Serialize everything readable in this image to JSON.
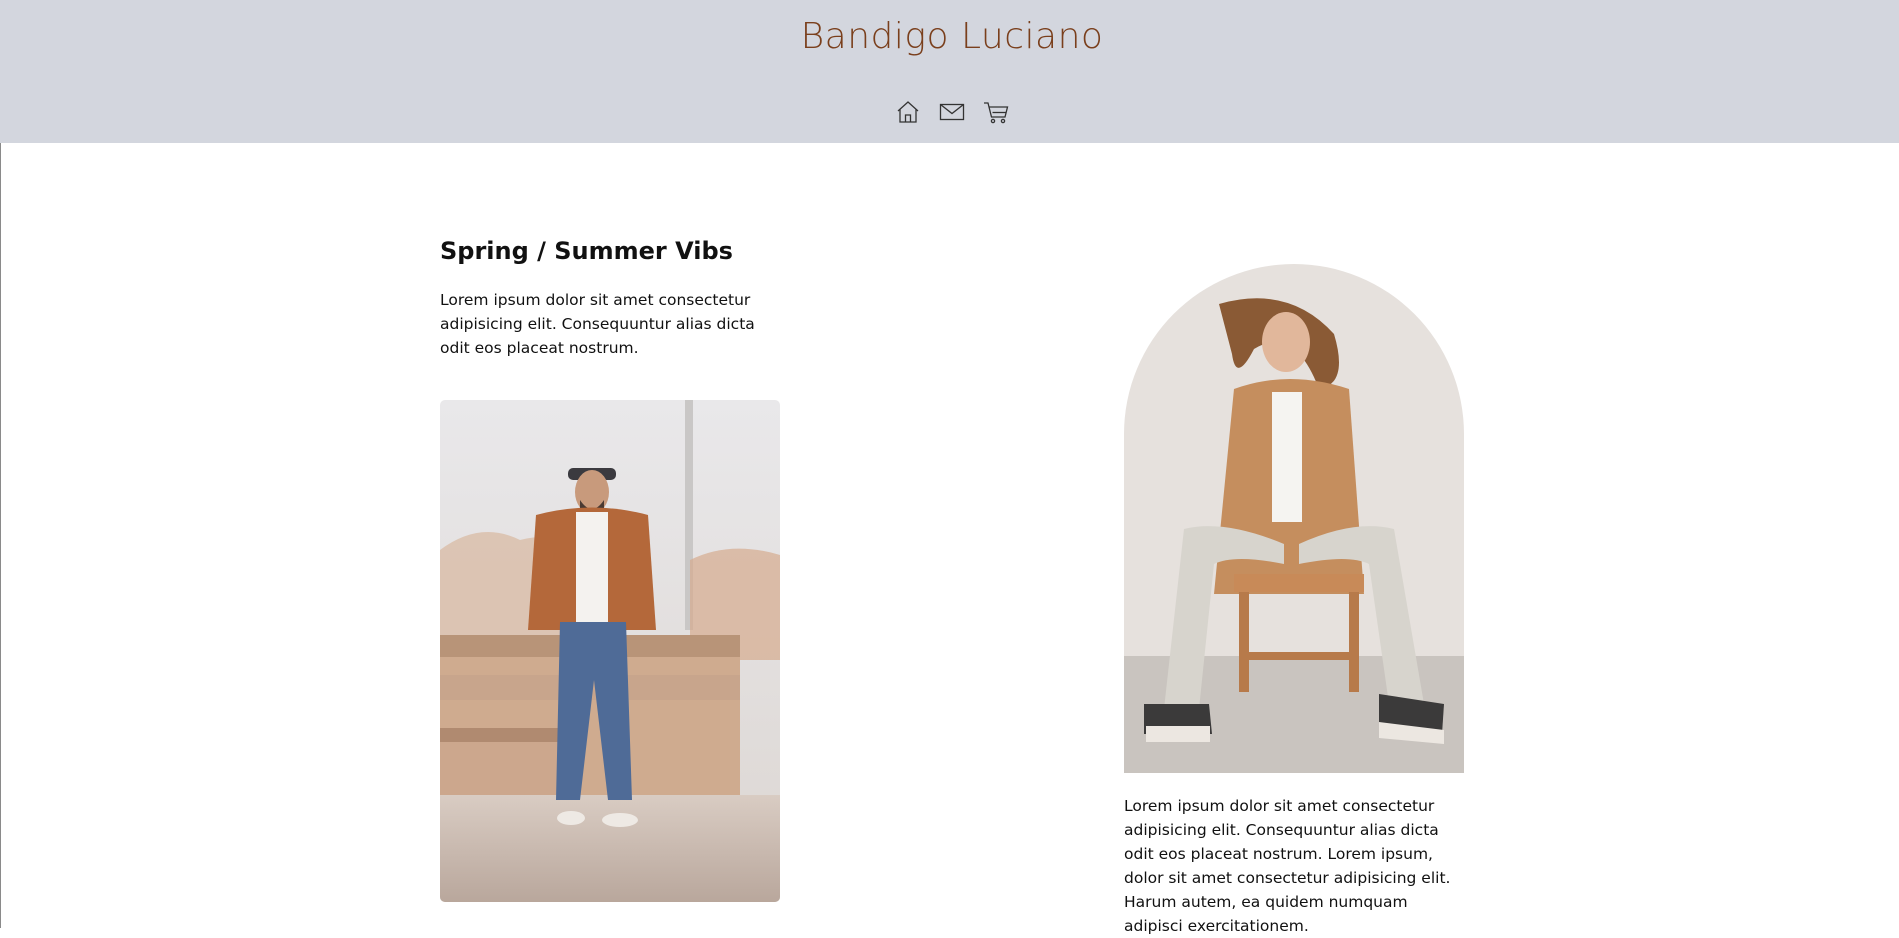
{
  "header": {
    "brand": "Bandigo Luciano",
    "brand_color": "#7a3f1c",
    "background": "#d3d6de",
    "nav_icons": [
      "home-icon",
      "mail-icon",
      "cart-icon"
    ]
  },
  "section": {
    "title": "Spring / Summer Vibs",
    "intro": "Lorem ipsum dolor sit amet consectetur adipisicing elit. Consequuntur alias dicta odit eos placeat nostrum.",
    "description": "Lorem ipsum dolor sit amet consectetur adipisicing elit. Consequuntur alias dicta odit eos placeat nostrum. Lorem ipsum, dolor sit amet consectetur adipisicing elit. Harum autem, ea quidem numquam adipisci exercitationem."
  }
}
